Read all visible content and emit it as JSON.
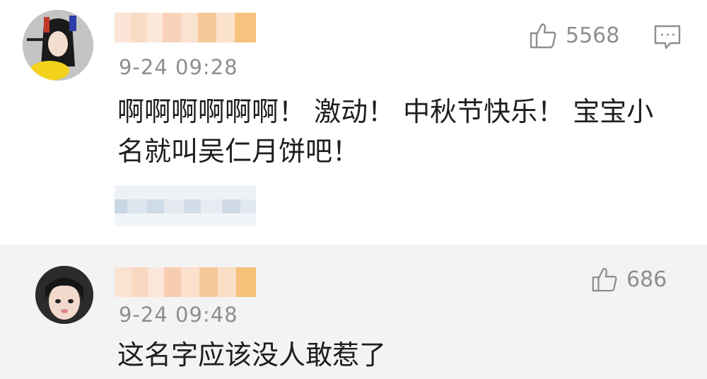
{
  "comments": [
    {
      "timestamp": "9-24 09:28",
      "text_lines": [
        "啊啊啊啊啊啊！ 激动！ 中秋节快乐！ 宝宝小",
        "名就叫吴仁月饼吧！"
      ],
      "like_count": "5568",
      "like_icon": "thumbs-up-icon",
      "reply_icon": "comment-bubble-icon"
    },
    {
      "timestamp": "9-24 09:48",
      "text_lines": [
        "这名字应该没人敢惹了"
      ],
      "like_count": "686",
      "like_icon": "thumbs-up-icon"
    }
  ],
  "colors": {
    "meta_gray": "#8e8e8e",
    "username_blur_orange": "#f6c89a",
    "subrow_blur_blue": "#c9d6e3"
  }
}
